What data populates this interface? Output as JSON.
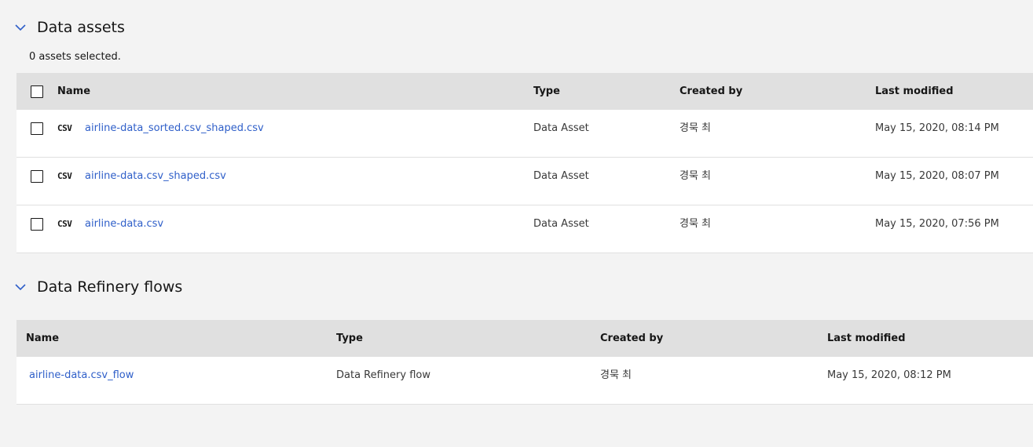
{
  "data_assets": {
    "section_title": "Data assets",
    "selection_status": "0 assets selected.",
    "columns": {
      "name": "Name",
      "type": "Type",
      "created_by": "Created by",
      "last_modified": "Last modified"
    },
    "rows": [
      {
        "icon": "CSV",
        "name": "airline-data_sorted.csv_shaped.csv",
        "type": "Data Asset",
        "created_by": "경묵 최",
        "last_modified": "May 15, 2020, 08:14 PM"
      },
      {
        "icon": "CSV",
        "name": "airline-data.csv_shaped.csv",
        "type": "Data Asset",
        "created_by": "경묵 최",
        "last_modified": "May 15, 2020, 08:07 PM"
      },
      {
        "icon": "CSV",
        "name": "airline-data.csv",
        "type": "Data Asset",
        "created_by": "경묵 최",
        "last_modified": "May 15, 2020, 07:56 PM"
      }
    ]
  },
  "refinery_flows": {
    "section_title": "Data Refinery flows",
    "columns": {
      "name": "Name",
      "type": "Type",
      "created_by": "Created by",
      "last_modified": "Last modified"
    },
    "rows": [
      {
        "name": "airline-data.csv_flow",
        "type": "Data Refinery flow",
        "created_by": "경묵 최",
        "last_modified": "May 15, 2020, 08:12 PM"
      }
    ]
  },
  "colors": {
    "background": "#f3f3f3",
    "header_row": "#e0e0e0",
    "link": "#2f5fc9",
    "chevron": "#2f5fc9"
  },
  "icons": {
    "section_toggle": "chevron-down-icon",
    "file_type": "csv-file-icon"
  }
}
